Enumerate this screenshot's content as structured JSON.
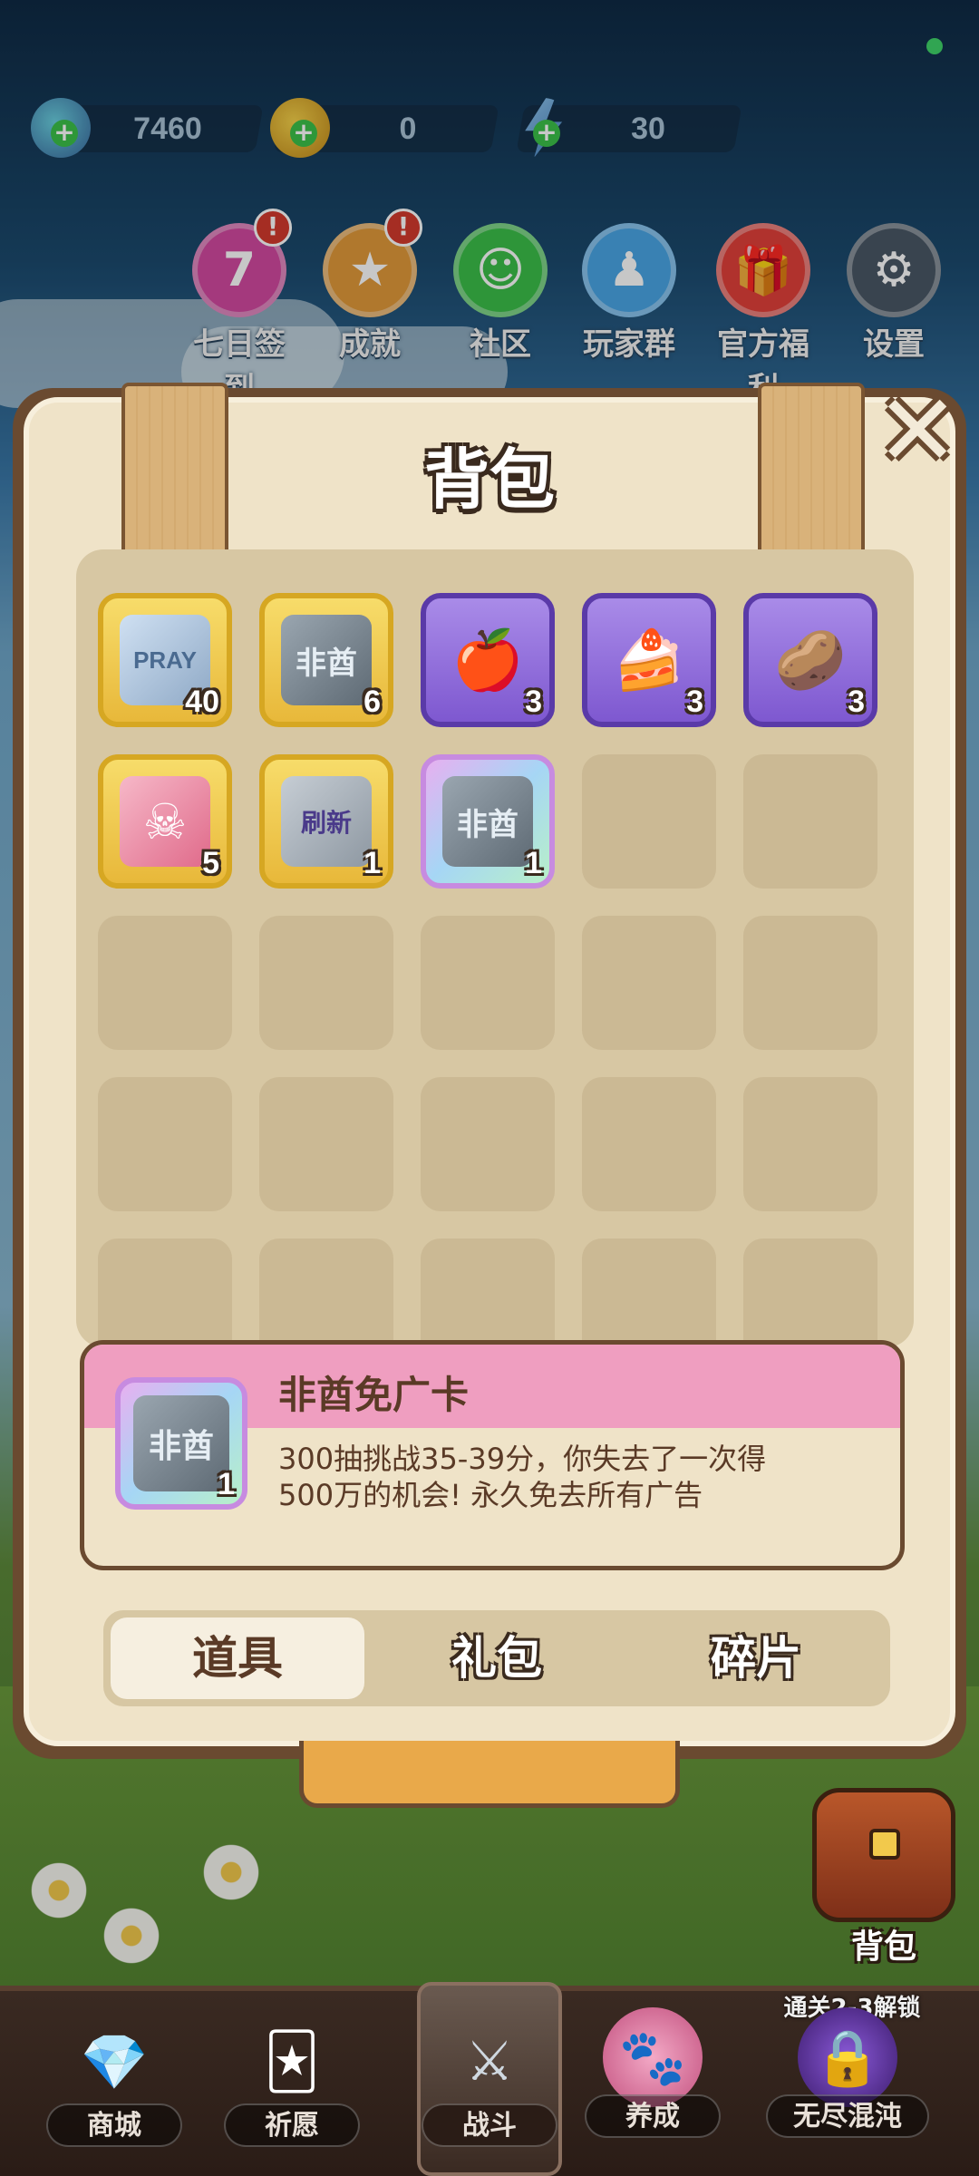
{
  "currencies": [
    {
      "name": "gem",
      "value": "7460"
    },
    {
      "name": "coin",
      "value": "0"
    },
    {
      "name": "energy",
      "value": "30"
    }
  ],
  "top_menu": [
    {
      "label": "七日签到",
      "glyph": "7",
      "color": "#d24aa0",
      "badge": "!"
    },
    {
      "label": "成就",
      "glyph": "★",
      "color": "#e29a3a",
      "badge": "!"
    },
    {
      "label": "社区",
      "glyph": "☺",
      "color": "#3bbf4a",
      "badge": ""
    },
    {
      "label": "玩家群",
      "glyph": "♟",
      "color": "#4aa6e6",
      "badge": ""
    },
    {
      "label": "官方福利",
      "glyph": "🎁",
      "color": "#e2403a",
      "badge": ""
    },
    {
      "label": "设置",
      "glyph": "⚙",
      "color": "#4a5866",
      "badge": ""
    }
  ],
  "panel": {
    "title": "背包",
    "close_glyph": "✕"
  },
  "inventory": [
    {
      "glyph": "PRAY",
      "count": "40",
      "rarity": "gold",
      "icon": "pray-ticket-icon"
    },
    {
      "glyph": "非酋",
      "count": "6",
      "rarity": "gold",
      "icon": "feiqiu-card-icon"
    },
    {
      "glyph": "🍎",
      "count": "3",
      "rarity": "purple",
      "icon": "apple-icon"
    },
    {
      "glyph": "🍰",
      "count": "3",
      "rarity": "purple",
      "icon": "cake-icon"
    },
    {
      "glyph": "🥔",
      "count": "3",
      "rarity": "purple",
      "icon": "chips-icon"
    },
    {
      "glyph": "☠",
      "count": "5",
      "rarity": "gold",
      "icon": "ghost-ticket-icon"
    },
    {
      "glyph": "刷新",
      "count": "1",
      "rarity": "gold",
      "icon": "refresh-ticket-icon"
    },
    {
      "glyph": "非酋",
      "count": "1",
      "rarity": "rainbow",
      "icon": "feiqiu-ad-card-icon"
    }
  ],
  "detail": {
    "title": "非酋免广卡",
    "icon_text": "非酋",
    "count": "1",
    "description": "300抽挑战35-39分，你失去了一次得500万的机会! 永久免去所有广告"
  },
  "tabs": [
    {
      "label": "道具",
      "active": true
    },
    {
      "label": "礼包",
      "active": false
    },
    {
      "label": "碎片",
      "active": false
    }
  ],
  "side_button": {
    "label": "背包"
  },
  "bottom_nav": [
    {
      "label": "商城",
      "glyph": "💎",
      "active": false
    },
    {
      "label": "祈愿",
      "glyph": "🃏",
      "active": false
    },
    {
      "label": "战斗",
      "glyph": "⚔",
      "active": true
    },
    {
      "label": "养成",
      "glyph": "🐾",
      "active": false
    },
    {
      "label": "无尽混沌",
      "glyph": "🔒",
      "active": false
    }
  ],
  "lock_note": "通关2-3解锁"
}
